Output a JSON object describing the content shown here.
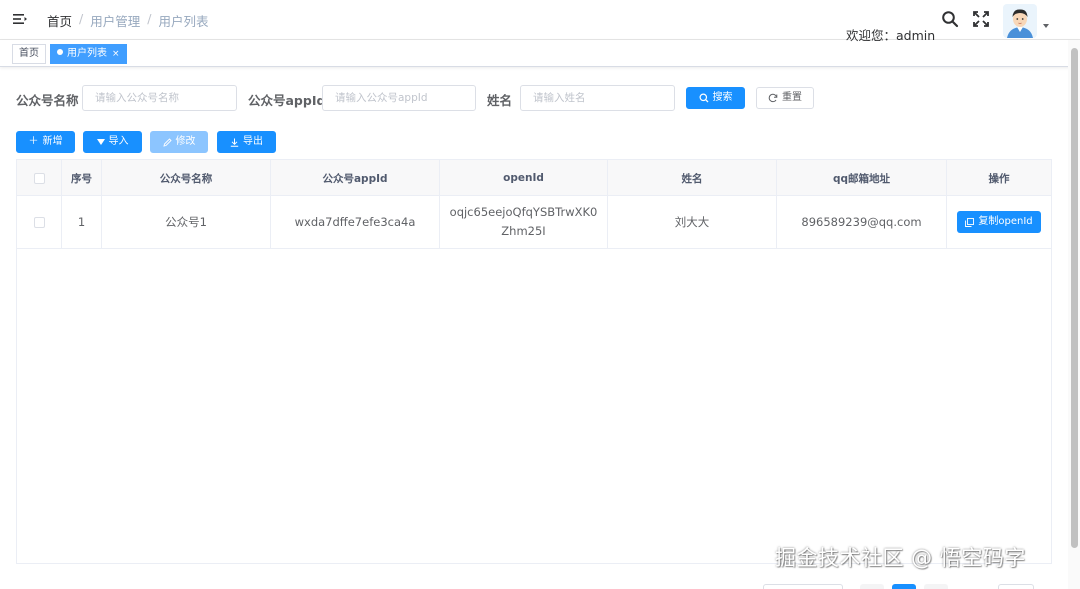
{
  "header": {
    "breadcrumb": [
      "首页",
      "用户管理",
      "用户列表"
    ],
    "separator": "/",
    "welcome": "欢迎您：admin"
  },
  "tags": [
    {
      "label": "首页",
      "active": false
    },
    {
      "label": "用户列表",
      "active": true,
      "close": "×"
    }
  ],
  "search": {
    "fields": [
      {
        "label": "公众号名称",
        "placeholder": "请输入公众号名称"
      },
      {
        "label": "公众号appId",
        "placeholder": "请输入公众号appId"
      },
      {
        "label": "姓名",
        "placeholder": "请输入姓名"
      }
    ],
    "search_button": "搜索",
    "reset_button": "重置"
  },
  "toolbar": {
    "add": "新增",
    "import": "导入",
    "edit": "修改",
    "export": "导出"
  },
  "table": {
    "columns": [
      "序号",
      "公众号名称",
      "公众号appId",
      "openId",
      "姓名",
      "qq邮箱地址",
      "操作"
    ],
    "rows": [
      {
        "index": "1",
        "account_name": "公众号1",
        "appid": "wxda7dffe7efe3ca4a",
        "openid": "oqjc65eejoQfqYSBTrwXK0Zhm25I",
        "name": "刘大大",
        "email": "896589239@qq.com",
        "action": "复制openId"
      }
    ]
  },
  "watermark": "掘金技术社区 @ 悟空码字",
  "colors": {
    "primary": "#1890ff",
    "tag_active": "#409eff",
    "disabled": "#8cc5ff"
  },
  "icons": [
    "hamburger-icon",
    "search-icon",
    "fullscreen-icon",
    "avatar",
    "plus-icon",
    "import-icon",
    "edit-icon",
    "export-icon",
    "refresh-icon",
    "copy-icon"
  ]
}
